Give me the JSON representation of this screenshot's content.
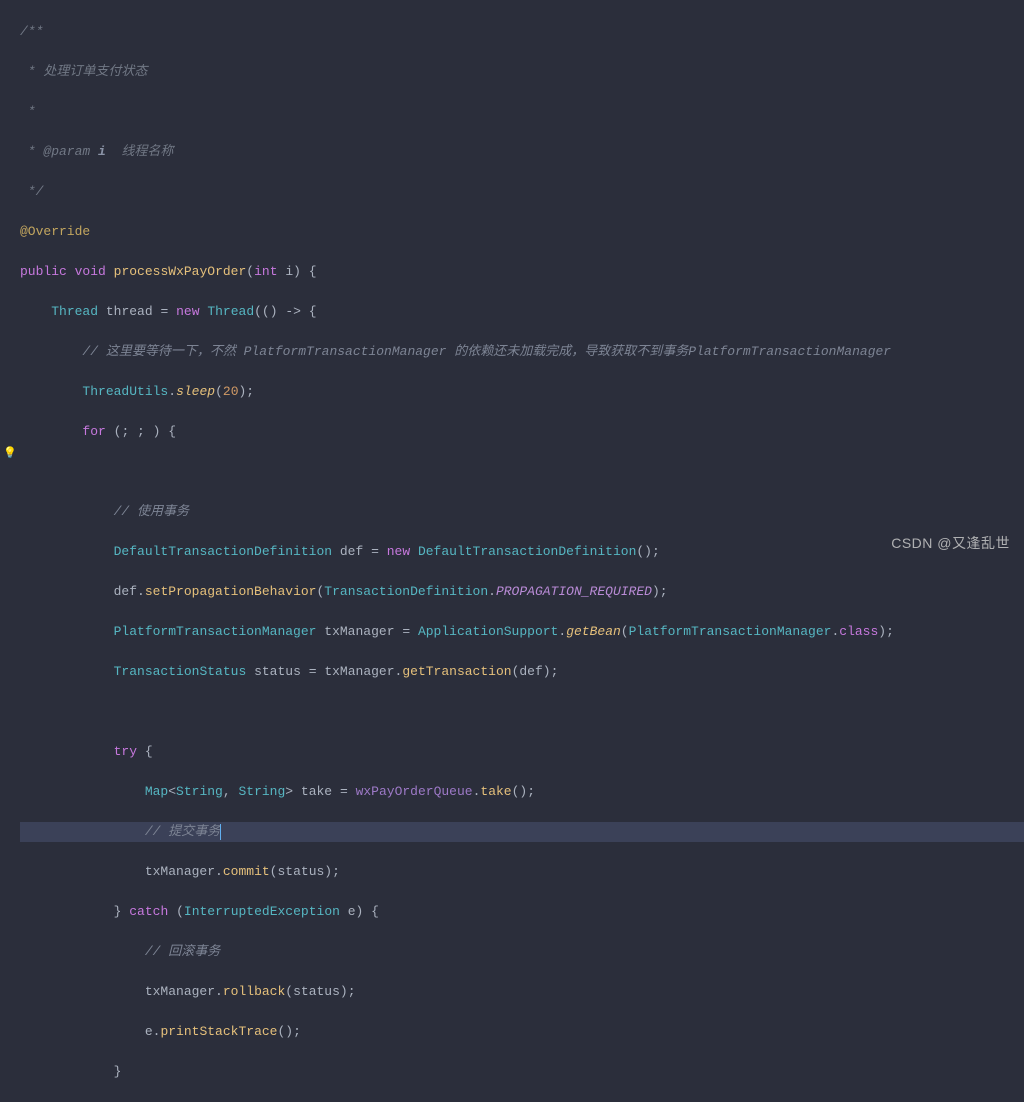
{
  "doc": {
    "open": "/**",
    "line1": " * 处理订单支付状态",
    "line2": " *",
    "paramTag": " * @param",
    "paramVar": " i",
    "paramDesc": "  线程名称",
    "close": " */"
  },
  "annotation": "@Override",
  "sig": {
    "public": "public",
    "void": "void",
    "name": "processWxPayOrder",
    "int": "int",
    "param": "i"
  },
  "thread": {
    "type": "Thread",
    "var": "thread",
    "new": "new",
    "ctor": "Thread"
  },
  "comments": {
    "waitCn": "// 这里要等待一下，不然 PlatformTransactionManager 的依赖还未加载完成，导致获取不到事务PlatformTransactionManager",
    "useTx": "// 使用事务",
    "commitTx": "// 提交事务",
    "rollbackTx": "// 回滚事务"
  },
  "sleep": {
    "cls": "ThreadUtils",
    "method": "sleep",
    "arg": "20"
  },
  "kw": {
    "for": "for",
    "new": "new",
    "try": "try",
    "catch": "catch"
  },
  "tx": {
    "defType": "DefaultTransactionDefinition",
    "defVar": "def",
    "setProp": "setPropagationBehavior",
    "txDefCls": "TransactionDefinition",
    "propReq": "PROPAGATION_REQUIRED",
    "ptmType": "PlatformTransactionManager",
    "txMgrVar": "txManager",
    "appSupport": "ApplicationSupport",
    "getBean": "getBean",
    "ptmClass": "PlatformTransactionManager",
    "classKw": "class",
    "statusType": "TransactionStatus",
    "statusVar": "status",
    "getTx": "getTransaction"
  },
  "take": {
    "mapType": "Map",
    "strType": "String",
    "var": "take",
    "queue": "wxPayOrderQueue",
    "method": "take"
  },
  "commit": {
    "obj": "txManager",
    "method": "commit",
    "arg": "status"
  },
  "catch": {
    "exType": "InterruptedException",
    "exVar": "e"
  },
  "rollback": {
    "obj": "txManager",
    "method": "rollback",
    "arg": "status"
  },
  "print": {
    "obj": "e",
    "method": "printStackTrace"
  },
  "watermark": "CSDN @又逢乱世"
}
